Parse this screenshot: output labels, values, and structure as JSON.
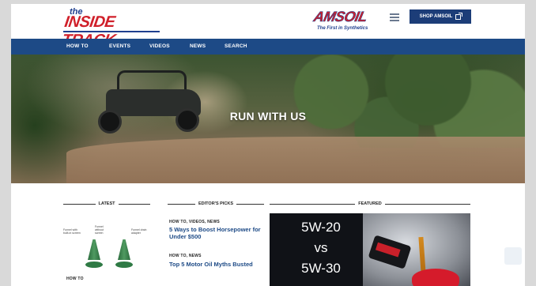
{
  "header": {
    "logo_small": "the",
    "logo_main": "INSIDE TRACK",
    "brand_name": "AMSOIL",
    "brand_tagline": "The First in Synthetics",
    "shop_label": "SHOP AMSOIL"
  },
  "nav": {
    "items": [
      "HOW TO",
      "EVENTS",
      "VIDEOS",
      "NEWS",
      "SEARCH"
    ]
  },
  "hero": {
    "title": "RUN WITH US"
  },
  "sections": {
    "latest": "LATEST",
    "editors_picks": "EDITOR'S PICKS",
    "featured": "FEATURED"
  },
  "latest": {
    "image_labels": [
      "Funnel with built-in screen",
      "Funnel without screen",
      "Funnel drain adapter"
    ],
    "category": "HOW TO"
  },
  "editors_picks": [
    {
      "category": "HOW TO, VIDEOS, NEWS",
      "title": "5 Ways to Boost Horsepower for Under $500"
    },
    {
      "category": "HOW TO, NEWS",
      "title": "Top 5 Motor Oil Myths Busted"
    }
  ],
  "featured": {
    "line1": "5W-20",
    "line2": "vs",
    "line3": "5W-30"
  },
  "colors": {
    "nav_blue": "#1d4a86",
    "brand_red": "#d0202a",
    "shop_button": "#1c3d78"
  }
}
